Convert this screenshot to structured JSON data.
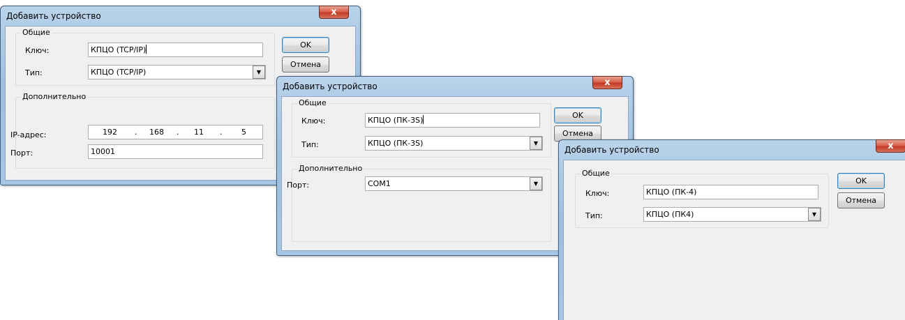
{
  "dialogs": [
    {
      "title": "Добавить устройство",
      "close_label": "x",
      "general_group": "Общие",
      "key_label": "Ключ:",
      "key_value": "КПЦО (TCP/IP)",
      "type_label": "Тип:",
      "type_value": "КПЦО (TCP/IP)",
      "extra_group": "Дополнительно",
      "ip_label": "IP-адрес:",
      "ip_octets": [
        "192",
        "168",
        "11",
        "5"
      ],
      "ip_separator": ".",
      "port_label": "Порт:",
      "port_value": "10001",
      "ok_label": "OK",
      "cancel_label": "Отмена"
    },
    {
      "title": "Добавить устройство",
      "close_label": "x",
      "general_group": "Общие",
      "key_label": "Ключ:",
      "key_value": "КПЦО (ПК-3S)",
      "type_label": "Тип:",
      "type_value": "КПЦО (ПК-3S)",
      "extra_group": "Дополнительно",
      "port_label": "Порт:",
      "port_value": "COM1",
      "ok_label": "OK",
      "cancel_label": "Отмена"
    },
    {
      "title": "Добавить устройство",
      "close_label": "x",
      "general_group": "Общие",
      "key_label": "Ключ:",
      "key_value": "КПЦО (ПК-4)",
      "type_label": "Тип:",
      "type_value": "КПЦО (ПК4)",
      "ok_label": "OK",
      "cancel_label": "Отмена"
    }
  ],
  "icons": {
    "close": "close-icon",
    "dropdown": "chevron-down-icon"
  }
}
